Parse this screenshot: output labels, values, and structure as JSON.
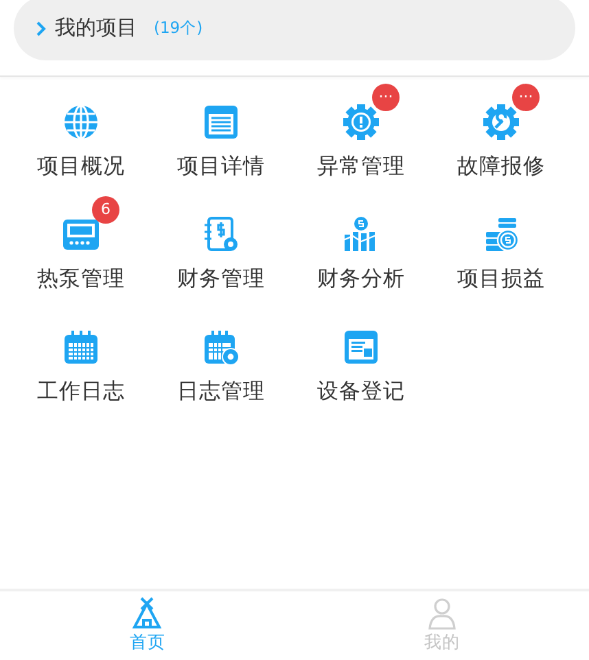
{
  "header": {
    "title": "我的项目",
    "count": "(19个)"
  },
  "menu": [
    {
      "label": "项目概况"
    },
    {
      "label": "项目详情"
    },
    {
      "label": "异常管理",
      "badge": "···"
    },
    {
      "label": "故障报修",
      "badge": "···"
    },
    {
      "label": "热泵管理",
      "badge": "6"
    },
    {
      "label": "财务管理"
    },
    {
      "label": "财务分析"
    },
    {
      "label": "项目损益"
    },
    {
      "label": "工作日志"
    },
    {
      "label": "日志管理"
    },
    {
      "label": "设备登记"
    }
  ],
  "tabbar": [
    {
      "label": "首页",
      "selected": true
    },
    {
      "label": "我的",
      "selected": false
    }
  ]
}
